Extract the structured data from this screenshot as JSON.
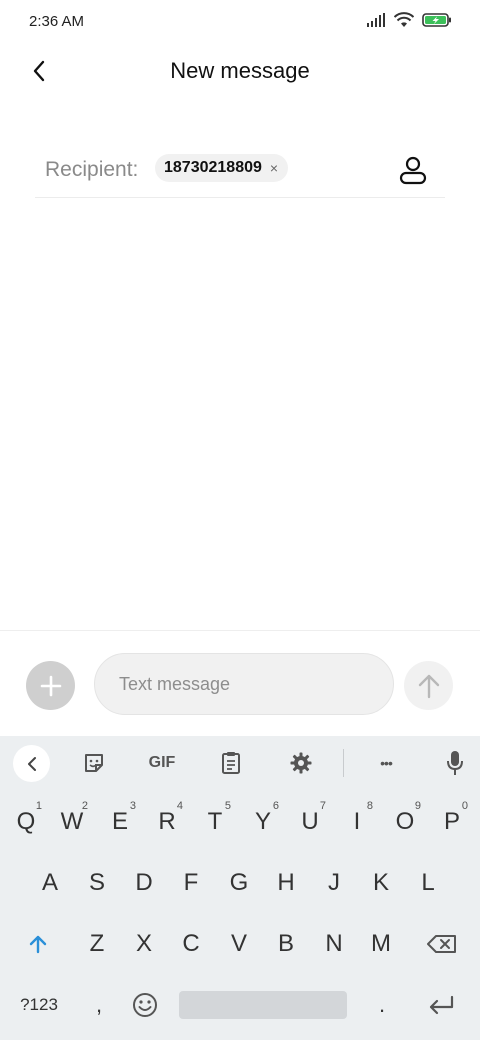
{
  "status_bar": {
    "time": "2:36 AM"
  },
  "header": {
    "title": "New message"
  },
  "recipient": {
    "label": "Recipient:",
    "chip_number": "18730218809",
    "chip_remove": "×"
  },
  "compose": {
    "placeholder": "Text message",
    "value": ""
  },
  "keyboard": {
    "toolbar": [
      "back",
      "sticker",
      "GIF",
      "clipboard",
      "settings",
      "more",
      "mic"
    ],
    "gif_label": "GIF",
    "more_label": "•••",
    "row1": [
      {
        "k": "Q",
        "h": "1"
      },
      {
        "k": "W",
        "h": "2"
      },
      {
        "k": "E",
        "h": "3"
      },
      {
        "k": "R",
        "h": "4"
      },
      {
        "k": "T",
        "h": "5"
      },
      {
        "k": "Y",
        "h": "6"
      },
      {
        "k": "U",
        "h": "7"
      },
      {
        "k": "I",
        "h": "8"
      },
      {
        "k": "O",
        "h": "9"
      },
      {
        "k": "P",
        "h": "0"
      }
    ],
    "row2": [
      "A",
      "S",
      "D",
      "F",
      "G",
      "H",
      "J",
      "K",
      "L"
    ],
    "row3": [
      "Z",
      "X",
      "C",
      "V",
      "B",
      "N",
      "M"
    ],
    "symbols_key": "?123",
    "comma_key": ",",
    "period_key": "."
  },
  "colors": {
    "shift_accent": "#2a8fd8",
    "plus_bg": "#cfcfcf"
  }
}
